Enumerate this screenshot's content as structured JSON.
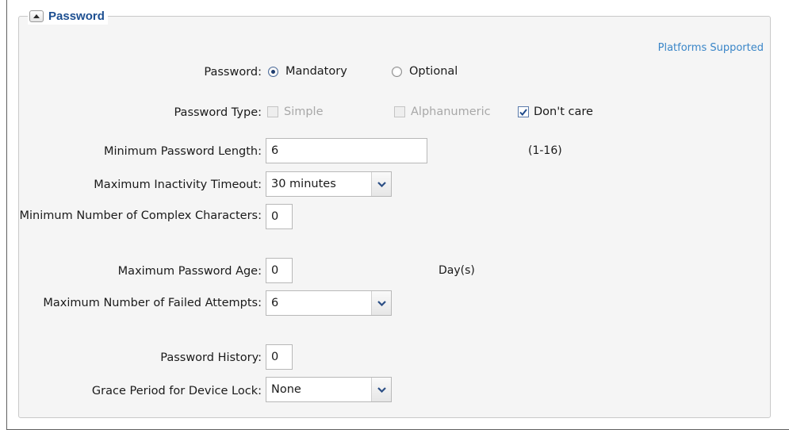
{
  "section": {
    "title": "Password",
    "platforms_link": "Platforms Supported"
  },
  "password": {
    "label": "Password:",
    "options": [
      {
        "label": "Mandatory",
        "selected": true
      },
      {
        "label": "Optional",
        "selected": false
      }
    ]
  },
  "password_type": {
    "label": "Password Type:",
    "options": [
      {
        "label": "Simple",
        "checked": false,
        "disabled": true
      },
      {
        "label": "Alphanumeric",
        "checked": false,
        "disabled": true
      },
      {
        "label": "Don't care",
        "checked": true,
        "disabled": false
      }
    ]
  },
  "min_length": {
    "label": "Minimum Password Length:",
    "value": "6",
    "hint": "(1-16)"
  },
  "inactivity_timeout": {
    "label": "Maximum Inactivity Timeout:",
    "value": "30 minutes"
  },
  "complex_chars": {
    "label": "Minimum Number of Complex Characters:",
    "value": "0"
  },
  "max_age": {
    "label": "Maximum Password Age:",
    "value": "0",
    "unit": "Day(s)"
  },
  "failed_attempts": {
    "label": "Maximum Number of Failed Attempts:",
    "value": "6"
  },
  "history": {
    "label": "Password History:",
    "value": "0"
  },
  "grace_period": {
    "label": "Grace Period for Device Lock:",
    "value": "None"
  },
  "colors": {
    "title": "#1d4f91",
    "link": "#3a86c8",
    "panel": "#f5f5f5",
    "border": "#c9c9c9"
  },
  "icons": {
    "collapse": "caret-up-icon",
    "dropdown": "chevron-down-icon",
    "check": "check-icon"
  }
}
